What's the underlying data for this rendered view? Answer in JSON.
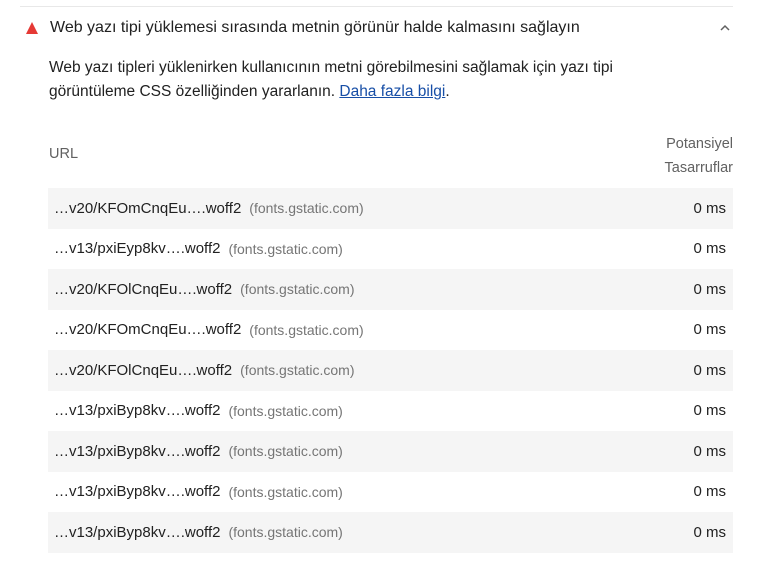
{
  "audit": {
    "title": "Web yazı tipi yüklemesi sırasında metnin görünür halde kalmasını sağlayın",
    "status_color": "#e53935",
    "status_icon": "triangle-warning-icon",
    "toggle_icon": "chevron-up-icon",
    "description_text": "Web yazı tipleri yüklenirken kullanıcının metni görebilmesini sağlamak için yazı tipi görüntüleme CSS özelliğinden yararlanın. ",
    "learn_more": "Daha fazla bilgi",
    "description_end": "."
  },
  "table": {
    "headers": {
      "url": "URL",
      "savings_line1": "Potansiyel",
      "savings_line2": "Tasarruflar"
    },
    "rows": [
      {
        "url": "…v20/KFOmCnqEu….woff2",
        "host": "(fonts.gstatic.com)",
        "savings": "0 ms"
      },
      {
        "url": "…v13/pxiEyp8kv….woff2",
        "host": "(fonts.gstatic.com)",
        "savings": "0 ms"
      },
      {
        "url": "…v20/KFOlCnqEu….woff2",
        "host": "(fonts.gstatic.com)",
        "savings": "0 ms"
      },
      {
        "url": "…v20/KFOmCnqEu….woff2",
        "host": "(fonts.gstatic.com)",
        "savings": "0 ms"
      },
      {
        "url": "…v20/KFOlCnqEu….woff2",
        "host": "(fonts.gstatic.com)",
        "savings": "0 ms"
      },
      {
        "url": "…v13/pxiByp8kv….woff2",
        "host": "(fonts.gstatic.com)",
        "savings": "0 ms"
      },
      {
        "url": "…v13/pxiByp8kv….woff2",
        "host": "(fonts.gstatic.com)",
        "savings": "0 ms"
      },
      {
        "url": "…v13/pxiByp8kv….woff2",
        "host": "(fonts.gstatic.com)",
        "savings": "0 ms"
      },
      {
        "url": "…v13/pxiByp8kv….woff2",
        "host": "(fonts.gstatic.com)",
        "savings": "0 ms"
      }
    ]
  }
}
